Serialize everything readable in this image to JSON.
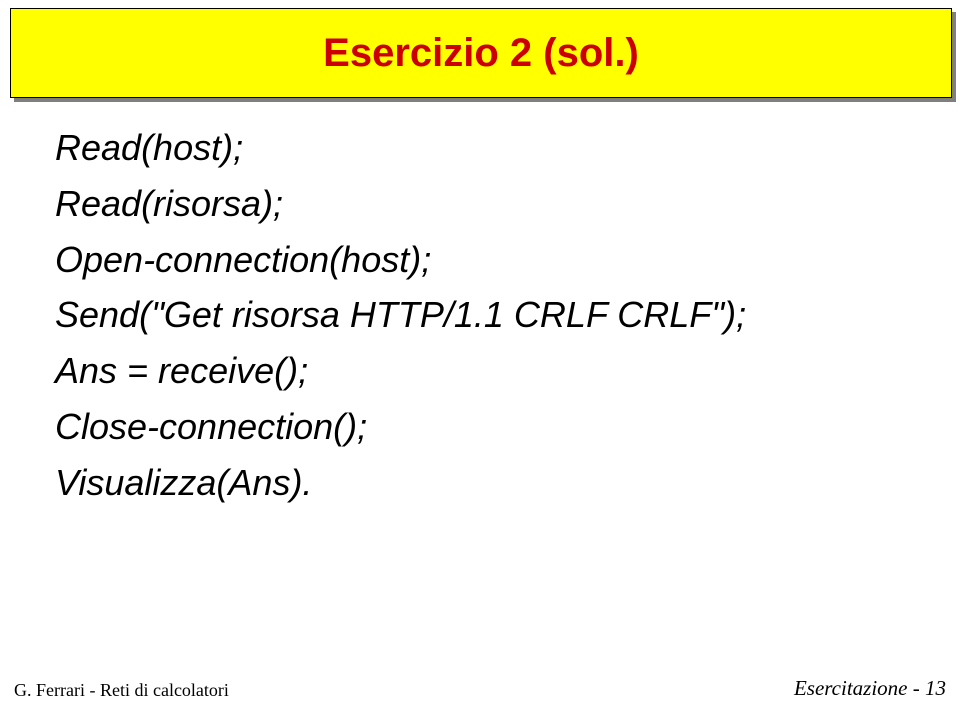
{
  "title": "Esercizio 2 (sol.)",
  "body": {
    "l1": "Read(host);",
    "l2": "Read(risorsa);",
    "l3": "Open-connection(host);",
    "l4": "Send(\"Get risorsa HTTP/1.1 CRLF CRLF\");",
    "l5": "Ans = receive();",
    "l6": "Close-connection();",
    "l7": "Visualizza(Ans)."
  },
  "footer": {
    "left": "G. Ferrari - Reti di calcolatori",
    "right": "Esercitazione - 13"
  }
}
